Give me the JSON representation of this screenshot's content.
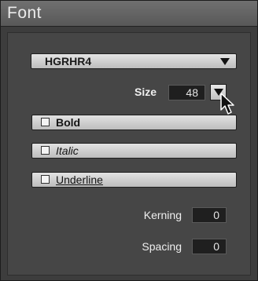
{
  "panel": {
    "title": "Font"
  },
  "font_select": {
    "value": "HGRHR4",
    "arrow_icon": "triangle-down-icon"
  },
  "size": {
    "label": "Size",
    "value": "48",
    "arrow_icon": "triangle-down-icon"
  },
  "styles": {
    "bold": {
      "label": "Bold",
      "checked": false
    },
    "italic": {
      "label": "Italic",
      "checked": false
    },
    "underline": {
      "label": "Underline",
      "checked": false
    }
  },
  "kerning": {
    "label": "Kerning",
    "value": "0"
  },
  "spacing": {
    "label": "Spacing",
    "value": "0"
  },
  "colors": {
    "panel_bg": "#3d3d3d",
    "title_bar": "#606060",
    "button_face": "#d0d0d0",
    "field_bg": "#1f1f1f"
  }
}
